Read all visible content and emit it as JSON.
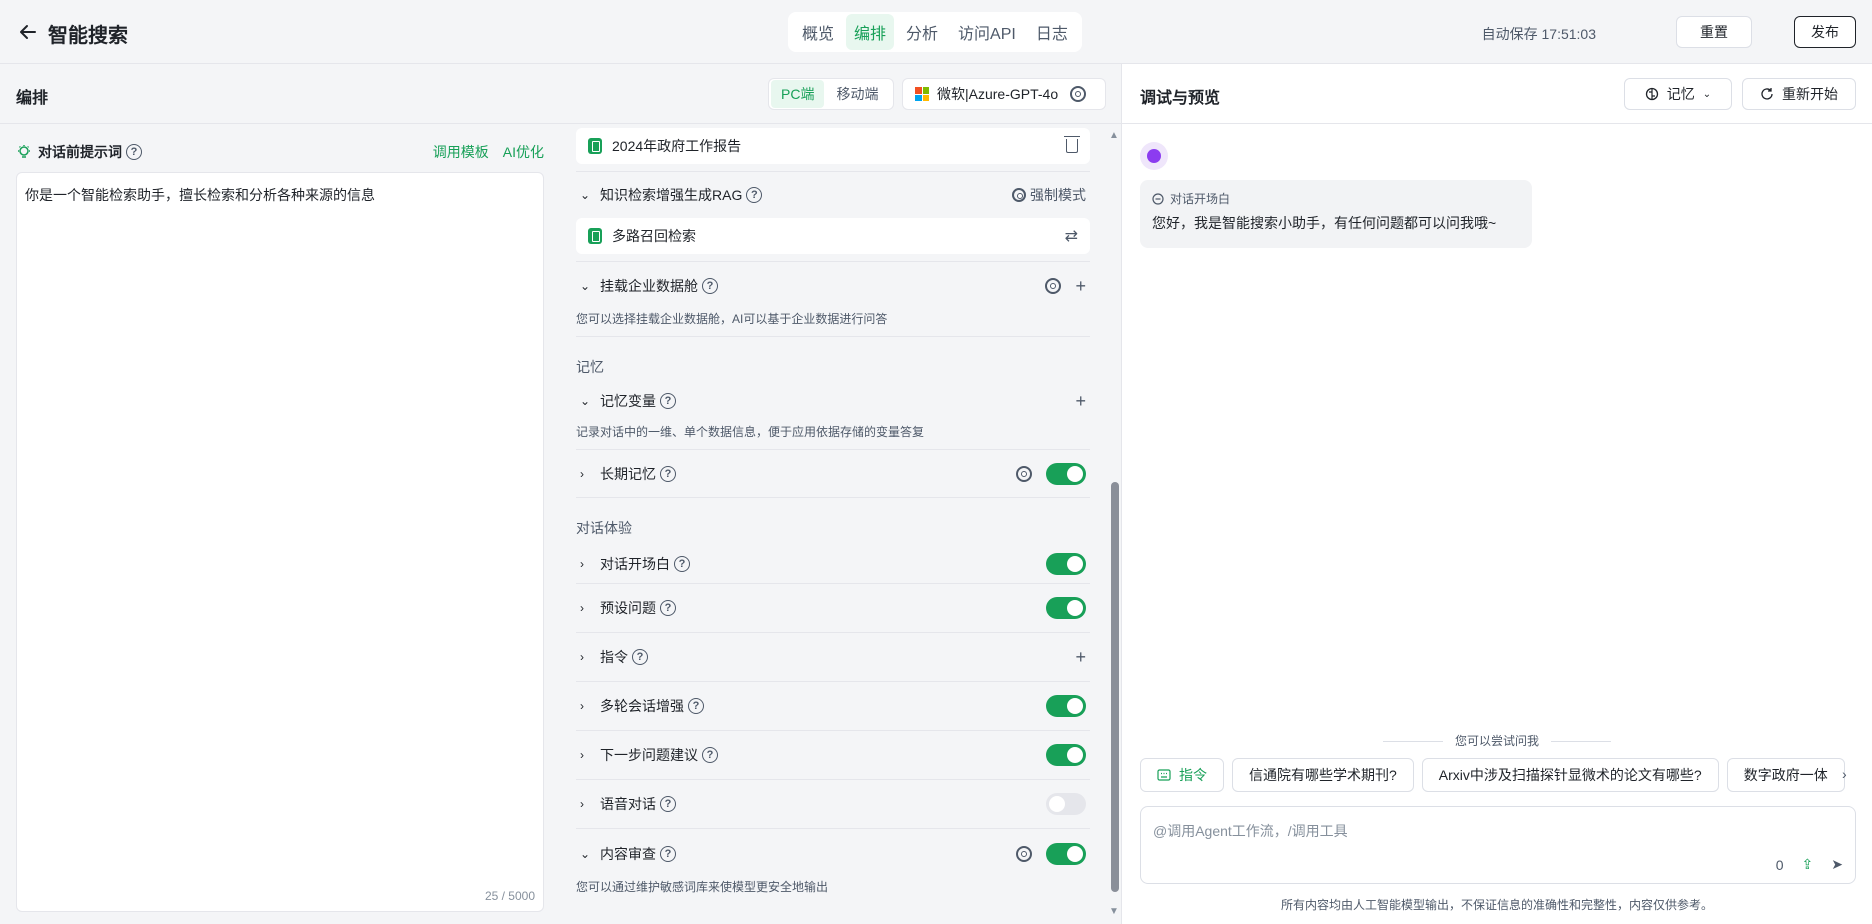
{
  "header": {
    "title": "智能搜索",
    "tabs": [
      "概览",
      "编排",
      "分析",
      "访问API",
      "日志"
    ],
    "active_tab": "编排",
    "autosave": "自动保存 17:51:03",
    "reset_label": "重置",
    "publish_label": "发布"
  },
  "editor": {
    "title": "编排",
    "device_tabs": [
      "PC端",
      "移动端"
    ],
    "model": "微软|Azure-GPT-4o",
    "prompt": {
      "label": "对话前提示词",
      "template_link": "调用模板",
      "optimize_link": "AI优化",
      "text": "你是一个智能检索助手，擅长检索和分析各种来源的信息",
      "counter": "25 / 5000"
    },
    "settings": {
      "knowledge_item": "2024年政府工作报告",
      "rag": {
        "name": "知识检索增强生成RAG",
        "mode": "强制模式",
        "item": "多路召回检索"
      },
      "data_cabin": {
        "name": "挂载企业数据舱",
        "desc": "您可以选择挂载企业数据舱，AI可以基于企业数据进行问答"
      },
      "memory_section": "记忆",
      "memory_var": {
        "name": "记忆变量",
        "desc": "记录对话中的一维、单个数据信息，便于应用依据存储的变量答复"
      },
      "long_memory": {
        "name": "长期记忆",
        "on": true
      },
      "experience_section": "对话体验",
      "experience_items": [
        {
          "name": "对话开场白",
          "control": "toggle",
          "on": true
        },
        {
          "name": "预设问题",
          "control": "toggle",
          "on": true
        },
        {
          "name": "指令",
          "control": "plus"
        },
        {
          "name": "多轮会话增强",
          "control": "toggle",
          "on": true
        },
        {
          "name": "下一步问题建议",
          "control": "toggle",
          "on": true
        },
        {
          "name": "语音对话",
          "control": "toggle",
          "on": false
        }
      ],
      "content_review": {
        "name": "内容审查",
        "on": true,
        "desc": "您可以通过维护敏感词库来使模型更安全地输出"
      }
    }
  },
  "preview": {
    "title": "调试与预览",
    "memory_label": "记忆",
    "restart_label": "重新开始",
    "opening_caption": "对话开场白",
    "opening_message": "您好，我是智能搜索小助手，有任何问题都可以问我哦~",
    "try_label": "您可以尝试问我",
    "command_chip": "指令",
    "suggestions": [
      "信通院有哪些学术期刊?",
      "Arxiv中涉及扫描探针显微术的论文有哪些?",
      "数字政府一体"
    ],
    "input_placeholder": "@调用Agent工作流，/调用工具",
    "count": "0",
    "disclaimer": "所有内容均由人工智能模型输出，不保证信息的准确性和完整性，内容仅供参考。"
  },
  "colors": {
    "accent": "#18a058",
    "accent_bg": "#e8f7ef",
    "text": "#1f2329",
    "muted": "#4e5969"
  }
}
